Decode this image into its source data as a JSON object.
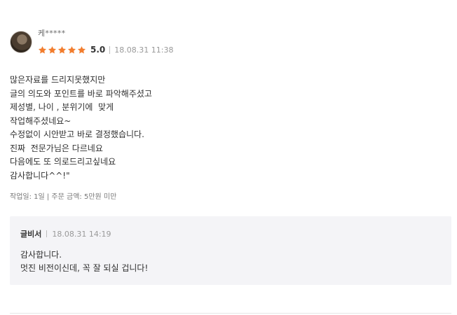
{
  "review": {
    "username": "케*****",
    "star_count": 5,
    "star_color": "#f27d2e",
    "rating": "5.0",
    "date": "18.08.31 11:38",
    "body_lines": [
      "많은자료를 드리지못했지만",
      "글의 의도와 포인트를 바로 파악해주셨고",
      "제성별, 나이 , 분위기에  맞게",
      "작업해주셨네요~",
      "수정없이 시안받고 바로 결정했습니다.",
      "진짜  전문가님은 다르네요",
      "다음에도 또 의로드리고싶네요",
      "감사합니다^^!\""
    ],
    "order_info": "작업일: 1일 | 주문 금액: 5만원 미만"
  },
  "reply": {
    "author": "글비서",
    "date": "18.08.31 14:19",
    "body_lines": [
      "감사합니다.",
      "멋진 비전이신데, 꼭 잘 되실 겁니다!"
    ]
  }
}
